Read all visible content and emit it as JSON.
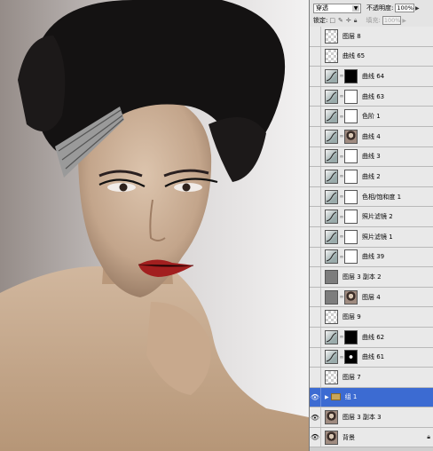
{
  "panel": {
    "blend_mode": "穿透",
    "opacity_label": "不透明度:",
    "opacity_value": "100%",
    "lock_label": "锁定:",
    "fill_label": "填充:",
    "fill_value": "100%"
  },
  "layers": [
    {
      "name": "图层 8",
      "visible": false,
      "thumb": "checker",
      "mask": null
    },
    {
      "name": "曲线 65",
      "visible": false,
      "thumb": "checker",
      "mask": null
    },
    {
      "name": "曲线 64",
      "visible": false,
      "thumb": "adj",
      "mask": "black"
    },
    {
      "name": "曲线 63",
      "visible": false,
      "thumb": "adj",
      "mask": "white"
    },
    {
      "name": "色阶 1",
      "visible": false,
      "thumb": "adj",
      "mask": "white"
    },
    {
      "name": "曲线 4",
      "visible": false,
      "thumb": "adj",
      "mask": "photo"
    },
    {
      "name": "曲线 3",
      "visible": false,
      "thumb": "adj",
      "mask": "white"
    },
    {
      "name": "曲线 2",
      "visible": false,
      "thumb": "adj",
      "mask": "white"
    },
    {
      "name": "色相/饱和度 1",
      "visible": false,
      "thumb": "adj",
      "mask": "white"
    },
    {
      "name": "照片滤镜 2",
      "visible": false,
      "thumb": "adj",
      "mask": "white"
    },
    {
      "name": "照片滤镜 1",
      "visible": false,
      "thumb": "adj",
      "mask": "white"
    },
    {
      "name": "曲线 39",
      "visible": false,
      "thumb": "adj",
      "mask": "white"
    },
    {
      "name": "图层 3 副本 2",
      "visible": false,
      "thumb": "gray",
      "mask": null
    },
    {
      "name": "图层 4",
      "visible": false,
      "thumb": "gray",
      "mask": "photo"
    },
    {
      "name": "图层 9",
      "visible": false,
      "thumb": "checker",
      "mask": null
    },
    {
      "name": "曲线 62",
      "visible": false,
      "thumb": "adj",
      "mask": "black"
    },
    {
      "name": "曲线 61",
      "visible": false,
      "thumb": "adj",
      "mask": "dark"
    },
    {
      "name": "图层 7",
      "visible": false,
      "thumb": "checker",
      "mask": null
    },
    {
      "name": "组 1",
      "visible": true,
      "thumb": "folder",
      "mask": null,
      "selected": true
    },
    {
      "name": "图层 3 副本 3",
      "visible": true,
      "thumb": "photo",
      "mask": null
    },
    {
      "name": "背景",
      "visible": true,
      "thumb": "photo",
      "mask": null,
      "locked": true
    }
  ]
}
